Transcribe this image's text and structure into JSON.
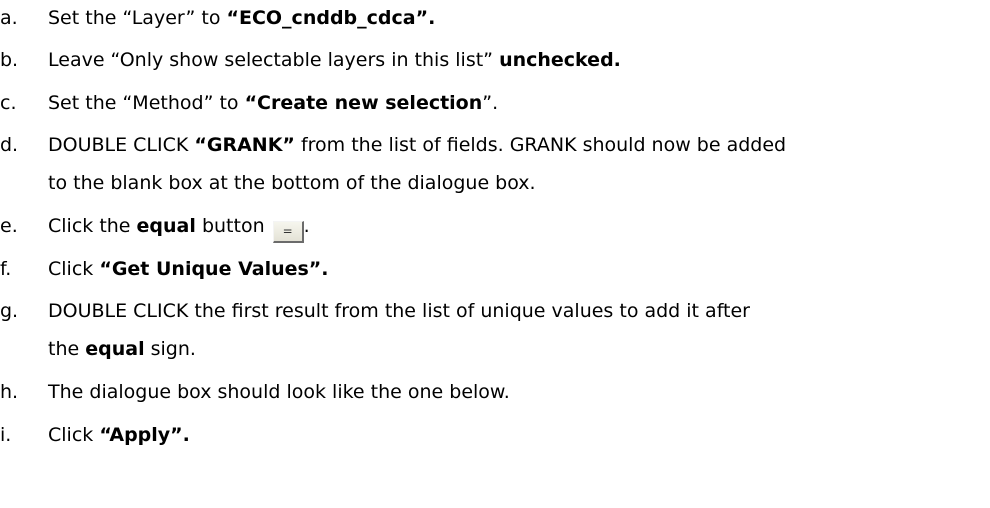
{
  "steps": [
    {
      "marker": "a.",
      "pre": "Set the “Layer” to ",
      "bold": "“ECO_cnddb_cdca”."
    },
    {
      "marker": "b.",
      "pre": "Leave “Only show selectable layers in this list” ",
      "bold": "unchecked."
    },
    {
      "marker": "c.",
      "pre": "Set the “Method” to ",
      "bold": "“Create new selection",
      "post": "”."
    },
    {
      "marker": "d.",
      "pre": "DOUBLE CLICK ",
      "bold": "“GRANK”",
      "post": " from the list of fields. GRANK should now be added",
      "line2": "to the blank box at the bottom of the dialogue box."
    },
    {
      "marker": "e.",
      "pre": "Click the ",
      "bold": "equal",
      "post": " button",
      "button_label": "=",
      "tail": "."
    },
    {
      "marker": "f.",
      "pre": "Click ",
      "bold": "“Get Unique Values”."
    },
    {
      "marker": "g.",
      "line1": "DOUBLE CLICK the first result from the list of unique values to add it after",
      "pre2": "the ",
      "bold2": "equal",
      "post2": " sign."
    },
    {
      "marker": "h.",
      "pre": "The dialogue box should look like the one below."
    },
    {
      "marker": "i.",
      "pre": "Click ",
      "bold": "“Apply”."
    }
  ]
}
